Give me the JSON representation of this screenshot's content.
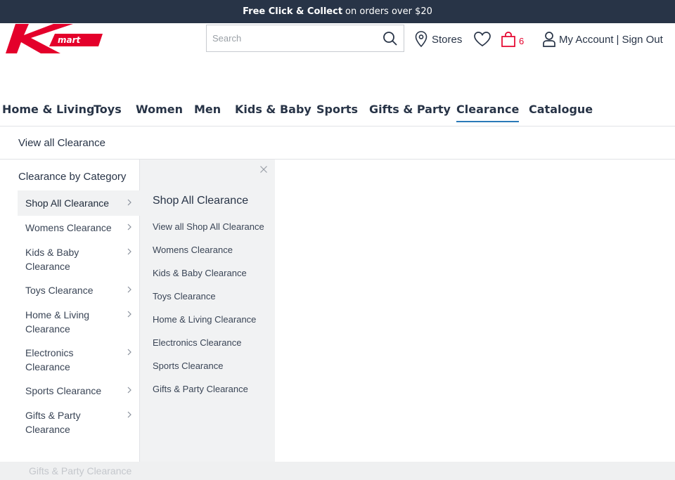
{
  "promo": {
    "bold": "Free Click & Collect",
    "rest": "on orders over $20"
  },
  "search": {
    "placeholder": "Search"
  },
  "header": {
    "stores_label": "Stores",
    "cart_count": "6",
    "account_label": "My Account",
    "separator": "|",
    "signout_label": "Sign Out"
  },
  "nav": {
    "items": [
      "Home & Living",
      "Toys",
      "Women",
      "Men",
      "Kids & Baby",
      "Sports",
      "Gifts & Party",
      "Clearance",
      "Catalogue"
    ],
    "active": "Clearance"
  },
  "view_all": "View all Clearance",
  "mega": {
    "category_heading": "Clearance by Category",
    "categories": [
      "Shop All Clearance",
      "Womens Clearance",
      "Kids & Baby Clearance",
      "Toys Clearance",
      "Home & Living Clearance",
      "Electronics Clearance",
      "Sports Clearance",
      "Gifts & Party Clearance"
    ],
    "sub_heading": "Shop All Clearance",
    "sub_links": [
      "View all Shop All Clearance",
      "Womens Clearance",
      "Kids & Baby Clearance",
      "Toys Clearance",
      "Home & Living Clearance",
      "Electronics Clearance",
      "Sports Clearance",
      "Gifts & Party Clearance"
    ]
  },
  "bottom_ghost": "Gifts & Party Clearance",
  "colors": {
    "brand_red": "#e4002b",
    "nav_text": "#283447",
    "active_underline": "#2a7ab8"
  }
}
